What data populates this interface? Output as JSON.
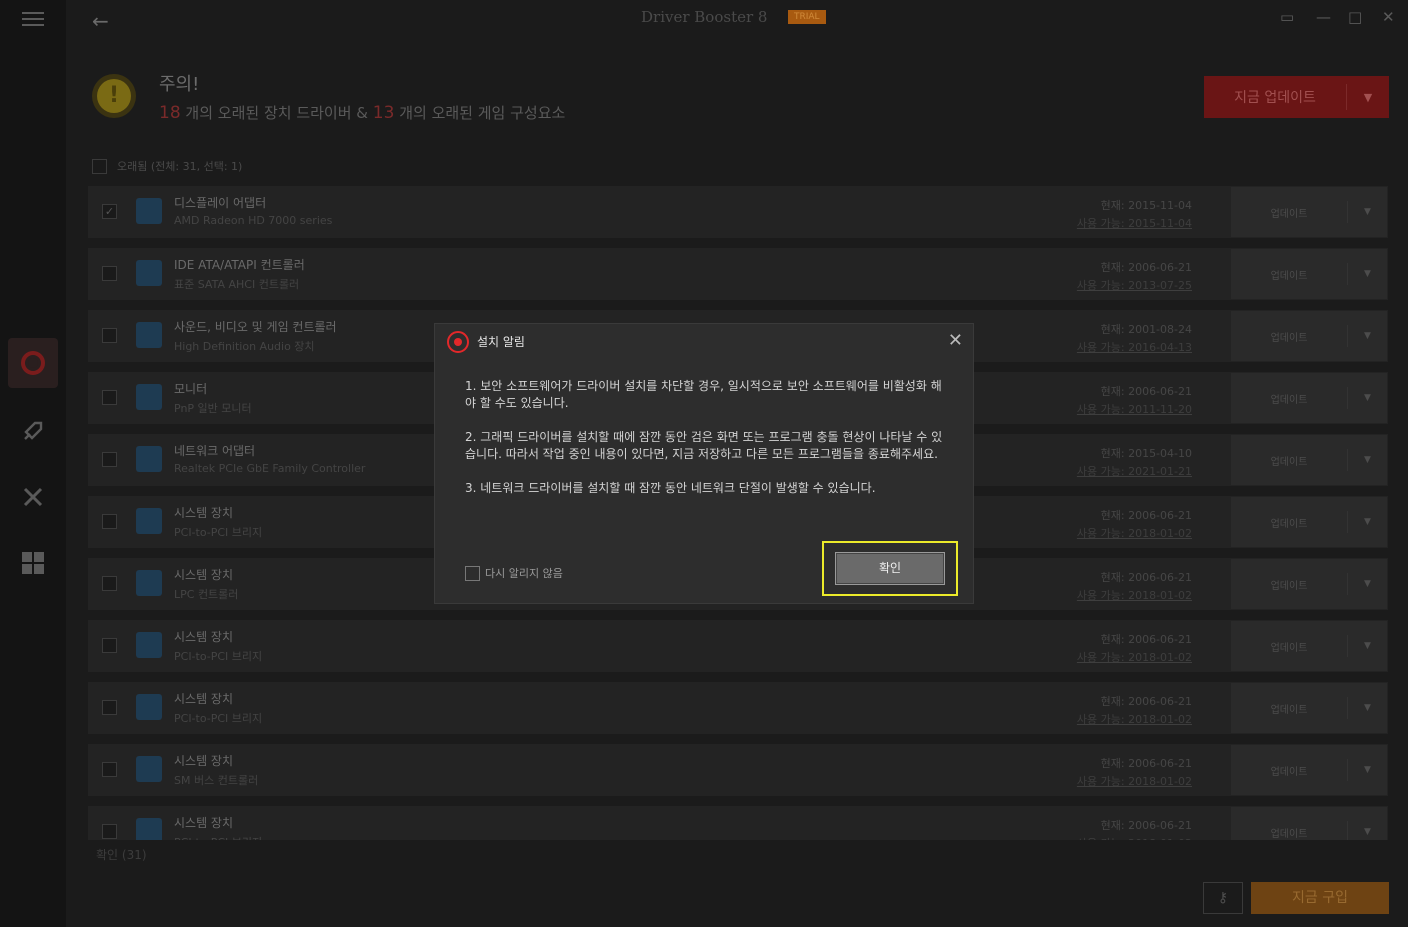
{
  "app": {
    "title": "Driver Booster 8",
    "trial_badge": "TRIAL"
  },
  "header": {
    "warning_title": "주의!",
    "outdated_device_count": "18",
    "outdated_device_text": "개의 오래된 장치 드라이버 &",
    "outdated_game_count": "13",
    "outdated_game_text": "개의 오래된 게임 구성요소",
    "update_now_label": "지금 업데이트",
    "accent_color": "#e02a2a"
  },
  "select_all_label": "오래됨 (전체: 31, 선택: 1)",
  "drivers": [
    {
      "name": "디스플레이 어댑터",
      "model": "AMD Radeon HD 7000 series",
      "current": "현재: 2015-11-04",
      "available": "사용 가능: 2015-11-04",
      "checked": true,
      "update_label": "업데이트"
    },
    {
      "name": "IDE ATA/ATAPI 컨트롤러",
      "model": "표준 SATA AHCI 컨트롤러",
      "current": "현재: 2006-06-21",
      "available": "사용 가능: 2013-07-25",
      "checked": false,
      "update_label": "업데이트"
    },
    {
      "name": "사운드, 비디오 및 게임 컨트롤러",
      "model": "High Definition Audio 장치",
      "current": "현재: 2001-08-24",
      "available": "사용 가능: 2016-04-13",
      "checked": false,
      "update_label": "업데이트"
    },
    {
      "name": "모니터",
      "model": "PnP 일반 모니터",
      "current": "현재: 2006-06-21",
      "available": "사용 가능: 2011-11-20",
      "checked": false,
      "update_label": "업데이트"
    },
    {
      "name": "네트워크 어댑터",
      "model": "Realtek PCIe GbE Family Controller",
      "current": "현재: 2015-04-10",
      "available": "사용 가능: 2021-01-21",
      "checked": false,
      "update_label": "업데이트"
    },
    {
      "name": "시스템 장치",
      "model": "PCI-to-PCI 브리지",
      "current": "현재: 2006-06-21",
      "available": "사용 가능: 2018-01-02",
      "checked": false,
      "update_label": "업데이트"
    },
    {
      "name": "시스템 장치",
      "model": "LPC 컨트롤러",
      "current": "현재: 2006-06-21",
      "available": "사용 가능: 2018-01-02",
      "checked": false,
      "update_label": "업데이트"
    },
    {
      "name": "시스템 장치",
      "model": "PCI-to-PCI 브리지",
      "current": "현재: 2006-06-21",
      "available": "사용 가능: 2018-01-02",
      "checked": false,
      "update_label": "업데이트"
    },
    {
      "name": "시스템 장치",
      "model": "PCI-to-PCI 브리지",
      "current": "현재: 2006-06-21",
      "available": "사용 가능: 2018-01-02",
      "checked": false,
      "update_label": "업데이트"
    },
    {
      "name": "시스템 장치",
      "model": "SM 버스 컨트롤러",
      "current": "현재: 2006-06-21",
      "available": "사용 가능: 2018-01-02",
      "checked": false,
      "update_label": "업데이트"
    },
    {
      "name": "시스템 장치",
      "model": "PCI-to-PCI 브리지",
      "current": "현재: 2006-06-21",
      "available": "사용 가능: 2018-01-02",
      "checked": false,
      "update_label": "업데이트"
    }
  ],
  "footer": {
    "ignore_count": "확인 (31)",
    "buy_now_label": "지금 구입"
  },
  "dialog": {
    "title": "설치 알림",
    "paragraphs": [
      "1. 보안 소프트웨어가 드라이버 설치를 차단할 경우, 일시적으로 보안 소프트웨어를 비활성화 해야 할 수도 있습니다.",
      "2. 그래픽 드라이버를 설치할 때에 잠깐 동안 검은 화면 또는 프로그램 충돌 현상이 나타날 수 있습니다. 따라서 작업 중인 내용이 있다면, 지금 저장하고 다른 모든 프로그램들을 종료해주세요.",
      "3. 네트워크 드라이버를 설치할 때 잠깐 동안 네트워크 단절이 발생할 수 있습니다."
    ],
    "dont_show_label": "다시 알리지 않음",
    "ok_label": "확인",
    "highlight_color": "#ecea2a"
  }
}
